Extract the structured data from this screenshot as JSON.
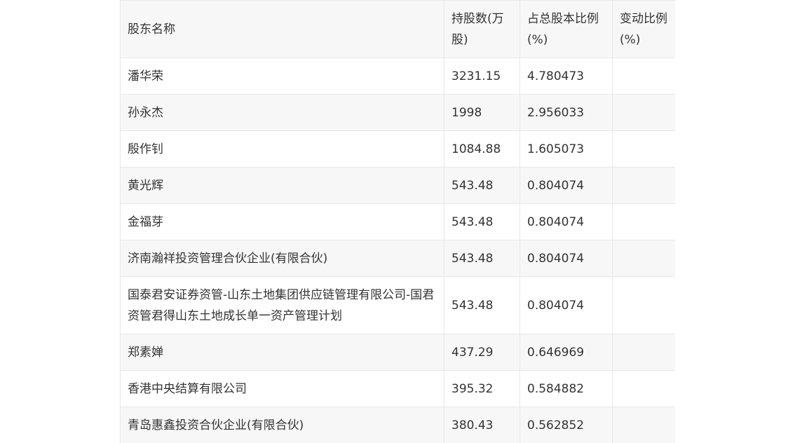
{
  "table": {
    "headers": [
      "股东名称",
      "持股数(万股)",
      "占总股本比例(%)",
      "变动比例(%)"
    ],
    "rows": [
      {
        "name": "潘华荣",
        "shares": "3231.15",
        "ratio": "4.780473",
        "change": ""
      },
      {
        "name": "孙永杰",
        "shares": "1998",
        "ratio": "2.956033",
        "change": ""
      },
      {
        "name": "殷作钊",
        "shares": "1084.88",
        "ratio": "1.605073",
        "change": ""
      },
      {
        "name": "黄光辉",
        "shares": "543.48",
        "ratio": "0.804074",
        "change": ""
      },
      {
        "name": "金福芽",
        "shares": "543.48",
        "ratio": "0.804074",
        "change": ""
      },
      {
        "name": "济南瀚祥投资管理合伙企业(有限合伙)",
        "shares": "543.48",
        "ratio": "0.804074",
        "change": ""
      },
      {
        "name": "国泰君安证券资管-山东土地集团供应链管理有限公司-国君资管君得山东土地成长单一资产管理计划",
        "shares": "543.48",
        "ratio": "0.804074",
        "change": ""
      },
      {
        "name": "郑素婵",
        "shares": "437.29",
        "ratio": "0.646969",
        "change": ""
      },
      {
        "name": "香港中央结算有限公司",
        "shares": "395.32",
        "ratio": "0.584882",
        "change": ""
      },
      {
        "name": "青岛惠鑫投资合伙企业(有限合伙)",
        "shares": "380.43",
        "ratio": "0.562852",
        "change": ""
      }
    ]
  }
}
